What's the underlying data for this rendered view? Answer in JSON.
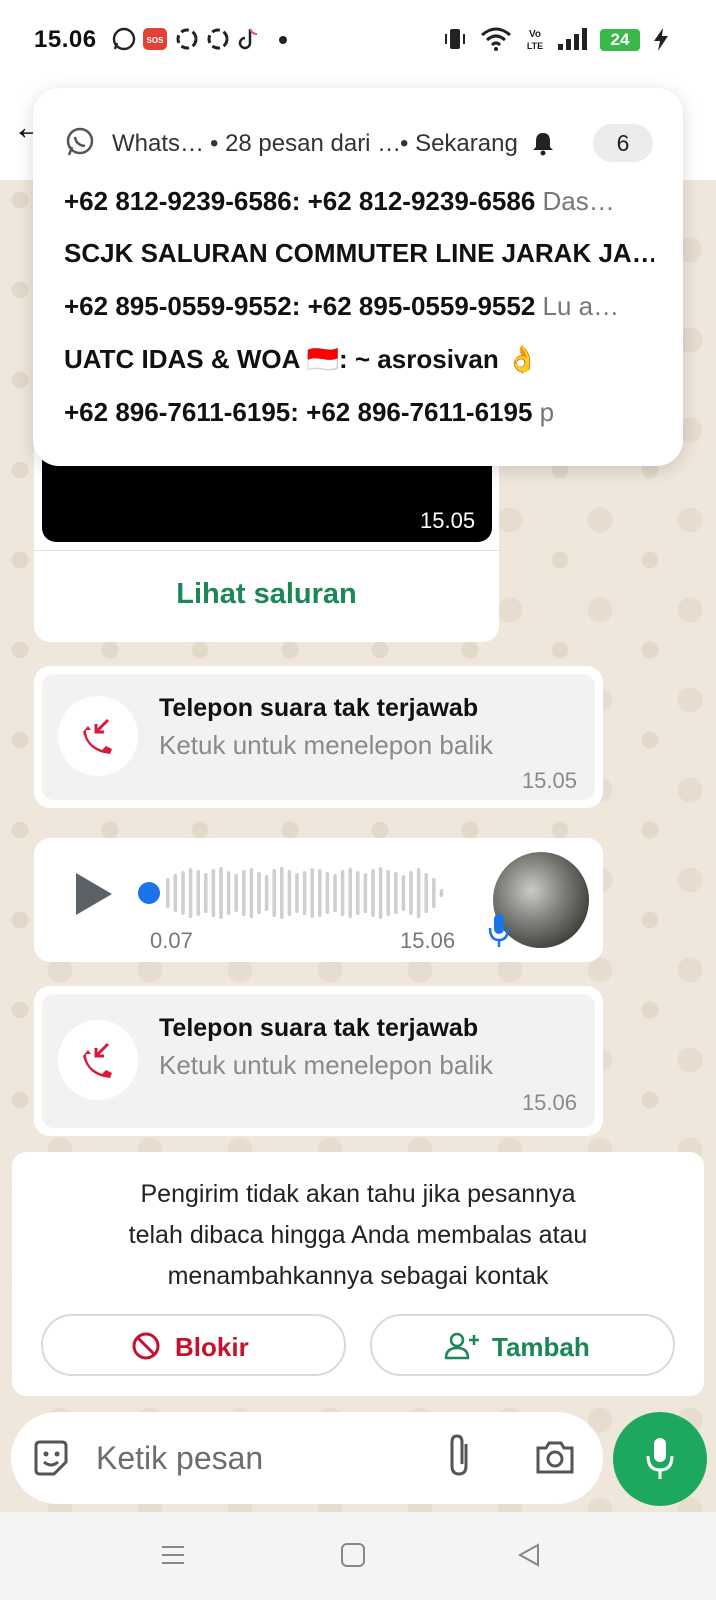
{
  "status_bar": {
    "time": "15.06",
    "battery": "24",
    "icons": [
      "whatsapp-icon",
      "sos-icon",
      "sync-icon",
      "sync-icon",
      "tiktok-icon",
      "dot-icon",
      "vibrate-icon",
      "wifi-icon",
      "volte-icon",
      "signal-icon",
      "battery-icon",
      "charging-icon"
    ]
  },
  "notification": {
    "app": "Whats…",
    "summary": "• 28 pesan dari …",
    "when": "• Sekarang",
    "count": "6",
    "messages": [
      {
        "sender": "+62 812-9239-6586: +62 812-9239-6586",
        "text": "Das…"
      },
      {
        "sender": "SCJK SALURAN COMMUTER LINE JARAK JA…",
        "text": ""
      },
      {
        "sender": "+62 895-0559-9552: +62 895-0559-9552",
        "text": "Lu a…"
      },
      {
        "sender": "UATC IDAS & WOA 🇮🇩: ~ asrosivan",
        "text": "👌"
      },
      {
        "sender": "+62 896-7611-6195: +62 896-7611-6195",
        "text": "p"
      }
    ]
  },
  "channel_card": {
    "video_time": "15.05",
    "view_channel": "Lihat saluran"
  },
  "calls": [
    {
      "title": "Telepon suara tak terjawab",
      "subtitle": "Ketuk untuk menelepon balik",
      "time": "15.05"
    },
    {
      "title": "Telepon suara tak terjawab",
      "subtitle": "Ketuk untuk menelepon balik",
      "time": "15.06"
    }
  ],
  "voice_note": {
    "duration": "0.07",
    "time": "15.06",
    "progress": 0
  },
  "unknown_sender": {
    "line1": "Pengirim tidak akan tahu jika pesannya",
    "line2": "telah dibaca hingga Anda membalas atau",
    "line3": "menambahkannya sebagai kontak",
    "block_label": "Blokir",
    "add_label": "Tambah",
    "block_color": "#c8102e",
    "add_color": "#1b8755"
  },
  "composer": {
    "placeholder": "Ketik pesan"
  },
  "colors": {
    "accent_green": "#1ea85f",
    "link_green": "#1b8755",
    "missed_call_red": "#d9183a",
    "seek_blue": "#1a73e8"
  }
}
